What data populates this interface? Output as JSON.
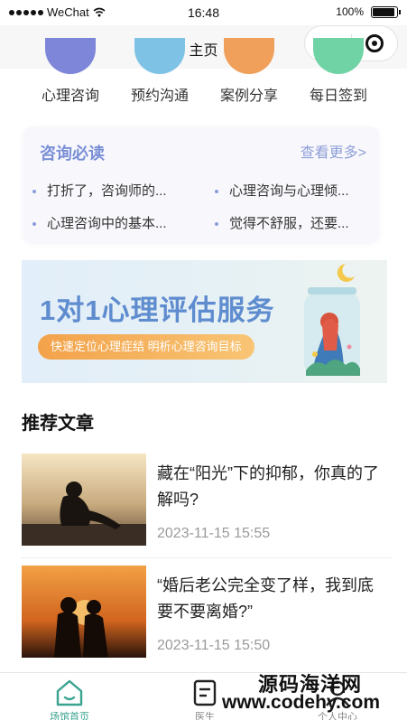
{
  "status_bar": {
    "carrier": "WeChat",
    "time": "16:48",
    "battery": "100%"
  },
  "nav": {
    "title": "主页",
    "more_glyph": "•••"
  },
  "quick_actions": [
    {
      "label": "心理咨询",
      "icon": "consult-icon",
      "color": "#7d86d8"
    },
    {
      "label": "预约沟通",
      "icon": "appointment-icon",
      "color": "#7ec2e6"
    },
    {
      "label": "案例分享",
      "icon": "case-icon",
      "color": "#f0a05a"
    },
    {
      "label": "每日签到",
      "icon": "checkin-icon",
      "color": "#6fd3a5"
    }
  ],
  "notice": {
    "title": "咨询必读",
    "more": "查看更多>",
    "items": [
      "打折了，咨询师的...",
      "心理咨询与心理倾...",
      "心理咨询中的基本...",
      "觉得不舒服，还要..."
    ]
  },
  "banner": {
    "title": "1对1心理评估服务",
    "subtitle": "快速定位心理症结 明析心理咨询目标"
  },
  "recommend": {
    "title": "推荐文章",
    "articles": [
      {
        "title": "藏在“阳光”下的抑郁，你真的了解吗?",
        "time": "2023-11-15 15:55"
      },
      {
        "title": "“婚后老公完全变了样，我到底要不要离婚?”",
        "time": "2023-11-15 15:50"
      }
    ]
  },
  "tab_bar": {
    "items": [
      {
        "label": "场馆首页",
        "icon": "home-icon",
        "active": true
      },
      {
        "label": "医生",
        "icon": "document-icon",
        "active": false
      },
      {
        "label": "个人中心",
        "icon": "user-icon",
        "active": false
      }
    ]
  },
  "watermark": {
    "line1": "源码海洋网",
    "line2": "www.codehy.com"
  },
  "colors": {
    "accent": "#3aa38f",
    "notice_title": "#7a8fd6",
    "banner_title": "#5e8ccf"
  }
}
